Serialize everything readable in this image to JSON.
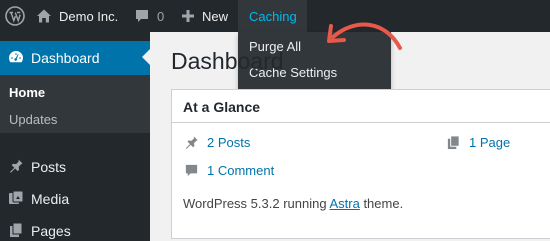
{
  "adminbar": {
    "site_name": "Demo Inc.",
    "comments_count": "0",
    "new_label": "New",
    "caching_label": "Caching"
  },
  "caching_menu": {
    "items": [
      {
        "label": "Purge All"
      },
      {
        "label": "Cache Settings"
      }
    ]
  },
  "sidebar": {
    "dashboard_label": "Dashboard",
    "submenu": [
      {
        "label": "Home"
      },
      {
        "label": "Updates"
      }
    ],
    "items": [
      {
        "label": "Posts",
        "icon": "pin-icon"
      },
      {
        "label": "Media",
        "icon": "media-icon"
      },
      {
        "label": "Pages",
        "icon": "pages-icon"
      }
    ]
  },
  "main": {
    "title": "Dashboard"
  },
  "widget": {
    "title": "At a Glance",
    "posts": "2 Posts",
    "pages": "1 Page",
    "comments": "1 Comment",
    "version_prefix": "WordPress 5.3.2 running",
    "theme_name": "Astra",
    "version_suffix": "theme."
  },
  "colors": {
    "adminbar_bg": "#23282d",
    "accent": "#0073aa",
    "highlight": "#00b9eb",
    "annotation": "#e8594a"
  }
}
